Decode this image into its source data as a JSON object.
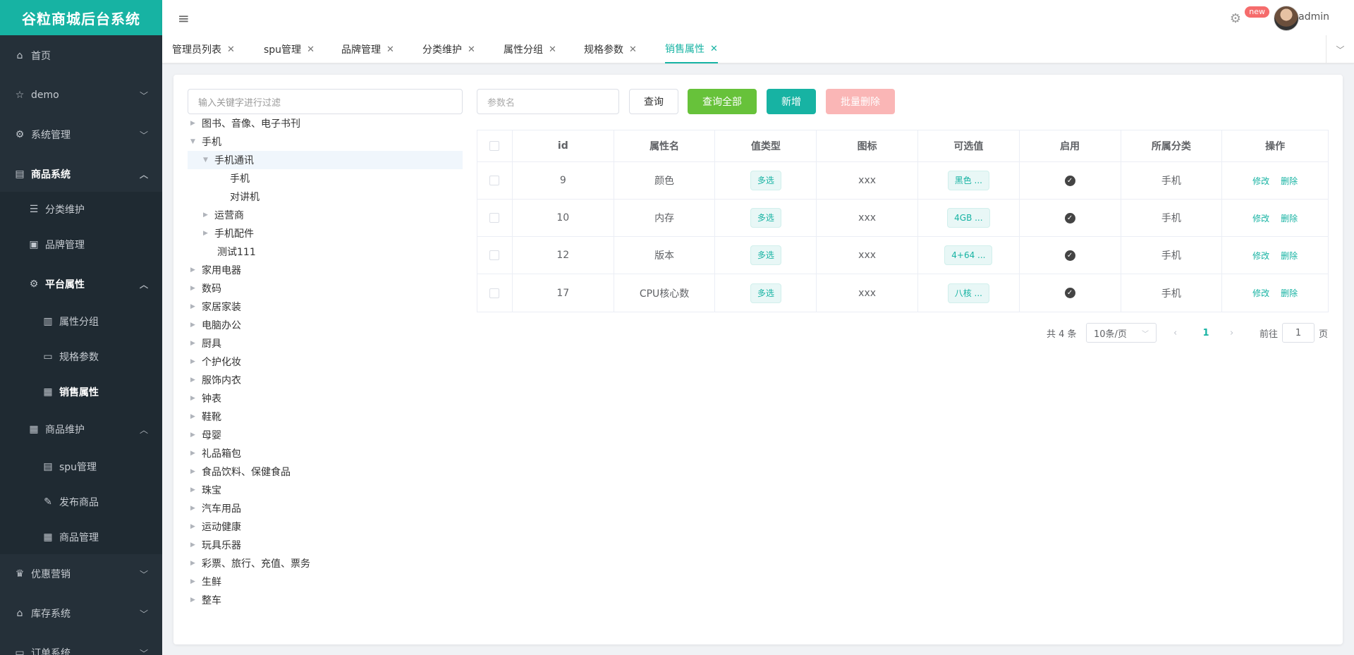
{
  "app": {
    "title": "谷粒商城后台系统"
  },
  "header": {
    "badge": "new",
    "username": "admin"
  },
  "sidebar": {
    "items": [
      {
        "label": "首页",
        "icon": "home-icon"
      },
      {
        "label": "demo",
        "icon": "star-icon"
      },
      {
        "label": "系统管理",
        "icon": "gear-icon"
      },
      {
        "label": "商品系统",
        "icon": "product-icon"
      },
      {
        "label": "分类维护",
        "icon": "list-icon"
      },
      {
        "label": "品牌管理",
        "icon": "brand-icon"
      },
      {
        "label": "平台属性",
        "icon": "gear-icon"
      },
      {
        "label": "属性分组",
        "icon": "bar-chart-icon"
      },
      {
        "label": "规格参数",
        "icon": "document-icon"
      },
      {
        "label": "销售属性",
        "icon": "grid-icon"
      },
      {
        "label": "商品维护",
        "icon": "grid-icon"
      },
      {
        "label": "spu管理",
        "icon": "doc-gear-icon"
      },
      {
        "label": "发布商品",
        "icon": "edit-icon"
      },
      {
        "label": "商品管理",
        "icon": "grid-icon"
      },
      {
        "label": "优惠营销",
        "icon": "trophy-icon"
      },
      {
        "label": "库存系统",
        "icon": "home-icon"
      },
      {
        "label": "订单系统",
        "icon": "document-icon"
      }
    ]
  },
  "tabs": [
    {
      "label": "管理员列表"
    },
    {
      "label": "spu管理"
    },
    {
      "label": "品牌管理"
    },
    {
      "label": "分类维护"
    },
    {
      "label": "属性分组"
    },
    {
      "label": "规格参数"
    },
    {
      "label": "销售属性"
    }
  ],
  "tree": {
    "placeholder": "输入关键字进行过滤",
    "nodes": [
      "图书、音像、电子书刊",
      "手机",
      "手机通讯",
      "手机",
      "对讲机",
      "运营商",
      "手机配件",
      "测试111",
      "家用电器",
      "数码",
      "家居家装",
      "电脑办公",
      "厨具",
      "个护化妆",
      "服饰内衣",
      "钟表",
      "鞋靴",
      "母婴",
      "礼品箱包",
      "食品饮料、保健食品",
      "珠宝",
      "汽车用品",
      "运动健康",
      "玩具乐器",
      "彩票、旅行、充值、票务",
      "生鲜",
      "整车"
    ]
  },
  "toolbar": {
    "param_placeholder": "参数名",
    "query": "查询",
    "query_all": "查询全部",
    "add": "新增",
    "batch_delete": "批量删除"
  },
  "table": {
    "headers": [
      "id",
      "属性名",
      "值类型",
      "图标",
      "可选值",
      "启用",
      "所属分类",
      "操作"
    ],
    "rows": [
      {
        "id": "9",
        "name": "颜色",
        "type": "多选",
        "icon": "xxx",
        "values": "黑色 ...",
        "category": "手机"
      },
      {
        "id": "10",
        "name": "内存",
        "type": "多选",
        "icon": "xxx",
        "values": "4GB ...",
        "category": "手机"
      },
      {
        "id": "12",
        "name": "版本",
        "type": "多选",
        "icon": "xxx",
        "values": "4+64 ...",
        "category": "手机"
      },
      {
        "id": "17",
        "name": "CPU核心数",
        "type": "多选",
        "icon": "xxx",
        "values": "八核 ...",
        "category": "手机"
      }
    ],
    "op_edit": "修改",
    "op_delete": "删除"
  },
  "pagination": {
    "total": "共 4 条",
    "page_size": "10条/页",
    "current": "1",
    "goto_prefix": "前往",
    "goto_value": "1",
    "goto_suffix": "页"
  },
  "colors": {
    "accent": "#17b3a3",
    "sidebar": "#253039",
    "success": "#67c23a",
    "danger_light": "#fab6b6"
  }
}
